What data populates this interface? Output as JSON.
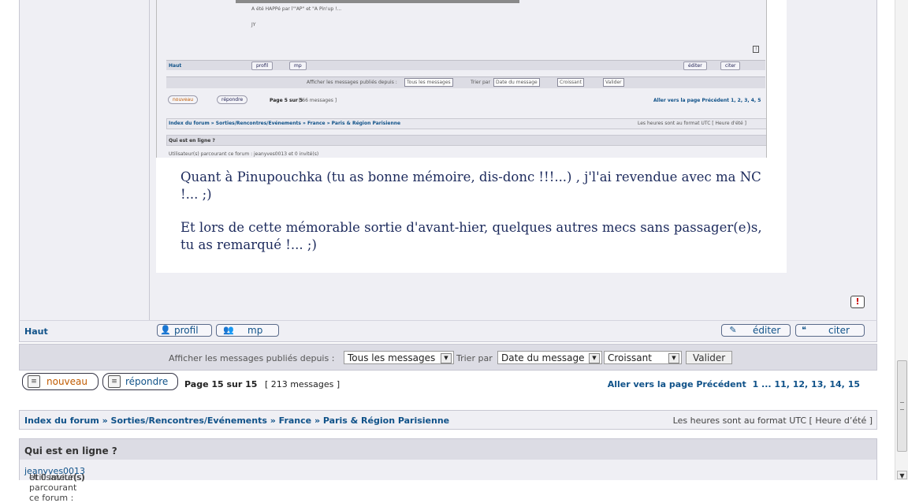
{
  "post": {
    "embedded_shot": {
      "caption_line1": "A été HAPPé par l'\"AP\" et \"A Pin'up !...",
      "caption_line2": "JY",
      "haut": "Haut",
      "profil": "profil",
      "mp": "mp",
      "editer": "éditer",
      "citer": "citer",
      "display_label": "Afficher les messages publiés depuis :",
      "display_value": "Tous les messages",
      "sort_label": "Trier par",
      "sort_value": "Date du message",
      "order_value": "Croissant",
      "valider": "Valider",
      "nouveau": "nouveau",
      "repondre": "répondre",
      "page_info": "Page 5 sur 5",
      "page_count": "[ 66 messages ]",
      "page_nav": "Aller vers la page Précédent 1, 2, 3, 4, 5",
      "breadcrumb": "Index du forum » Sorties/Rencontres/Evénements » France » Paris & Région Parisienne",
      "timezone": "Les heures sont au format UTC [ Heure d'été ]",
      "online_title": "Qui est en ligne ?",
      "online_text": "Utilisateur(s) parcourant ce forum : jeanyves0013 et 0 invité(s)"
    },
    "paragraph1": "Quant à Pinupouchka (tu as bonne mémoire, dis-donc !!!...) , j'l'ai revendue avec ma NC !... ;)",
    "paragraph2": "Et lors de cette mémorable sortie d'avant-hier, quelques autres mecs sans passager(e)s, tu as remarqué !...   ;)",
    "report_icon": "exclamation-icon"
  },
  "actions": {
    "haut": "Haut",
    "profil": "profil",
    "mp": "mp",
    "editer": "éditer",
    "citer": "citer"
  },
  "display_options": {
    "since_label": "Afficher les messages publiés depuis :",
    "since_value": "Tous les messages",
    "sort_label": "Trier par",
    "sort_value": "Date du message",
    "order_value": "Croissant",
    "submit": "Valider"
  },
  "pagination": {
    "nouveau": "nouveau",
    "repondre": "répondre",
    "page_label": "Page 15 sur 15",
    "message_count": "[ 213 messages ]",
    "goto_label": "Aller vers la page Précédent",
    "pages": "1 ... 11, 12, 13, 14, 15"
  },
  "breadcrumb": {
    "path": "Index du forum » Sorties/Rencontres/Evénements » France » Paris & Région Parisienne",
    "timezone": "Les heures sont au format UTC [ Heure d’été ]"
  },
  "online": {
    "title": "Qui est en ligne ?",
    "prefix": "Utilisateur(s) parcourant ce forum :",
    "user": "jeanyves0013",
    "suffix": "et 0 invité(s)"
  }
}
